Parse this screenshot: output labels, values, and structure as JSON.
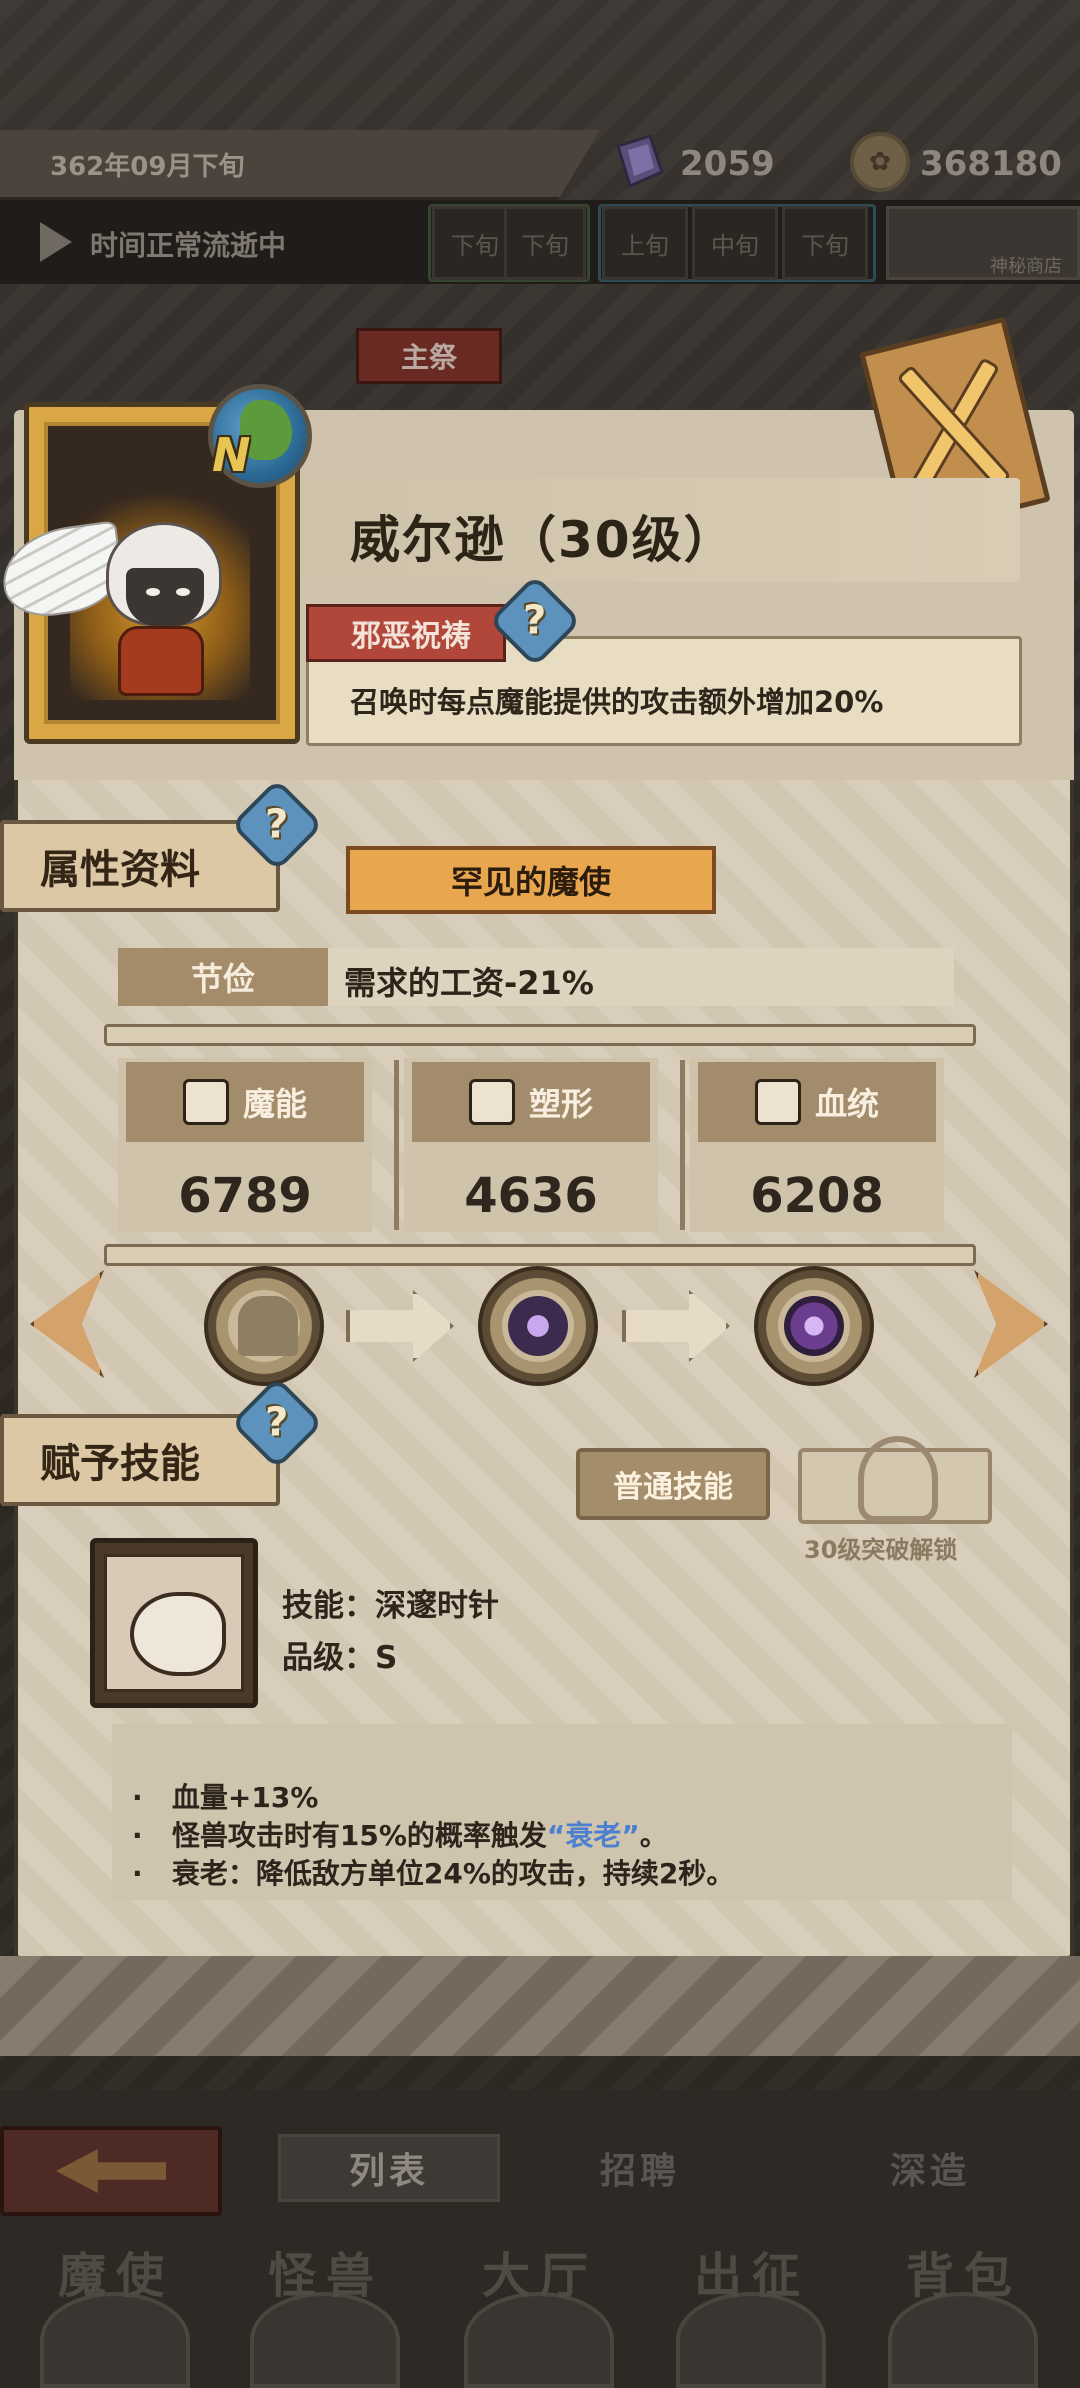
{
  "top_status": {
    "date": "362年09月下旬",
    "gem_count": "2059",
    "coin_count": "368180",
    "time_status": "时间正常流逝中",
    "time_slots_a": [
      "下旬",
      "下旬"
    ],
    "time_slots_b": [
      "上旬",
      "中旬",
      "下旬"
    ],
    "scene_thumb_label": "神秘商店",
    "main_tag": "主祭"
  },
  "character": {
    "rarity_letter": "N",
    "name": "威尔逊（30级）",
    "trait_name": "邪恶祝祷",
    "trait_help": "?",
    "trait_desc": "召唤时每点魔能提供的攻击额外增加20%"
  },
  "attributes": {
    "section_title": "属性资料",
    "section_help": "?",
    "rarity_title": "罕见的魔使",
    "thrift_label": "节俭",
    "thrift_value": "需求的工资-21%",
    "stats": [
      {
        "label": "魔能",
        "value": "6789",
        "icon": "magic-icon"
      },
      {
        "label": "塑形",
        "value": "4636",
        "icon": "shape-icon"
      },
      {
        "label": "血统",
        "value": "6208",
        "icon": "bloodline-icon"
      }
    ]
  },
  "skill": {
    "section_title": "赋予技能",
    "section_help": "?",
    "type_button": "普通技能",
    "lock_caption": "30级突破解锁",
    "name_line": "技能：深邃时针",
    "grade_line": "品级：S",
    "effect_bullet": "·",
    "effect_1": "血量+13%",
    "effect_2_pre": "怪兽攻击时有15%的概率触发",
    "effect_2_kw": "“衰老”",
    "effect_2_post": "。",
    "effect_3": "衰老：降低敌方单位24%的攻击，持续2秒。"
  },
  "subtabs": {
    "list": "列表",
    "recruit": "招聘",
    "forge": "深造"
  },
  "main_tabs": [
    "魔使",
    "怪兽",
    "大厅",
    "出征",
    "背包"
  ],
  "colors": {
    "accent_keyword": "#4b7fd0",
    "trait_tag": "#b1463b",
    "rarity_ribbon": "#e8a64e"
  }
}
